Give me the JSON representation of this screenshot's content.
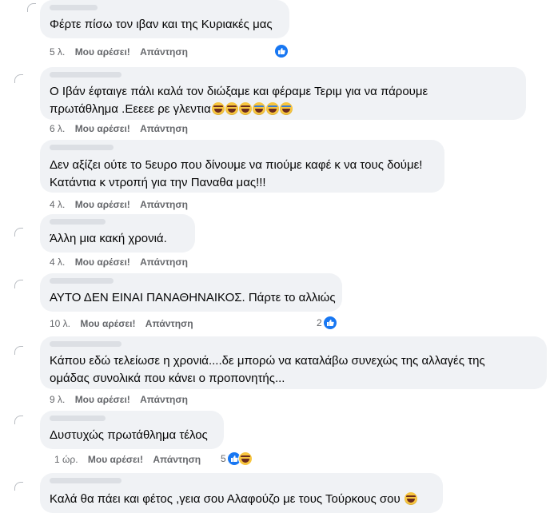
{
  "comments": [
    {
      "lines": [
        "Φέρτε πίσω τον ιβαν και της Κυριακές μας"
      ],
      "time": "5 λ.",
      "like": "Μου αρέσει!",
      "reply": "Απάντηση",
      "reaction_count": ""
    },
    {
      "lines": [
        "Ο Ιβάν έφταιγε πάλι καλά τον διώξαμε και φέραμε Τεριμ για να πάρουμε",
        "πρωτάθλημα .Εεεεε ρε γλεντια"
      ],
      "time": "6 λ.",
      "like": "Μου αρέσει!",
      "reply": "Απάντηση",
      "reaction_count": ""
    },
    {
      "lines": [
        "Δεν αξίζει ούτε το 5ευρο που δίνουμε να πιούμε καφέ κ να τους δούμε!",
        "Κατάντια κ ντροπή για την Παναθα μας!!!"
      ],
      "time": "4 λ.",
      "like": "Μου αρέσει!",
      "reply": "Απάντηση",
      "reaction_count": ""
    },
    {
      "lines": [
        "Άλλη μια κακή χρονιά."
      ],
      "time": "4 λ.",
      "like": "Μου αρέσει!",
      "reply": "Απάντηση",
      "reaction_count": ""
    },
    {
      "lines": [
        "ΑΥΤΟ ΔΕΝ ΕΙΝΑΙ ΠΑΝΑΘΗΝΑΙΚΟΣ. Πάρτε το αλλιώς"
      ],
      "time": "10 λ.",
      "like": "Μου αρέσει!",
      "reply": "Απάντηση",
      "reaction_count": "2"
    },
    {
      "lines": [
        "Κάπου εδώ τελείωσε η χρονιά....δε μπορώ να καταλάβω συνεχώς της αλλαγές της",
        "ομάδας συνολικά που κάνει ο προπονητής..."
      ],
      "time": "9 λ.",
      "like": "Μου αρέσει!",
      "reply": "Απάντηση",
      "reaction_count": ""
    },
    {
      "lines": [
        "Δυστυχώς πρωτάθλημα τέλος"
      ],
      "time": "1 ώρ.",
      "like": "Μου αρέσει!",
      "reply": "Απάντηση",
      "reaction_count": "5"
    },
    {
      "lines": [
        "Καλά θα πάει και φέτος ,γεια σου Αλαφούζο με τους Τούρκους σου"
      ],
      "time": "",
      "like": "",
      "reply": "",
      "reaction_count": ""
    }
  ],
  "icons": {
    "like": "like-icon",
    "haha": "haha-icon",
    "laugh_emoji": "laughing-emoji",
    "cry_emoji": "tears-of-joy-emoji"
  },
  "colors": {
    "bubble": "#f0f2f5",
    "meta": "#65676b",
    "like_blue": "#1877f2"
  }
}
